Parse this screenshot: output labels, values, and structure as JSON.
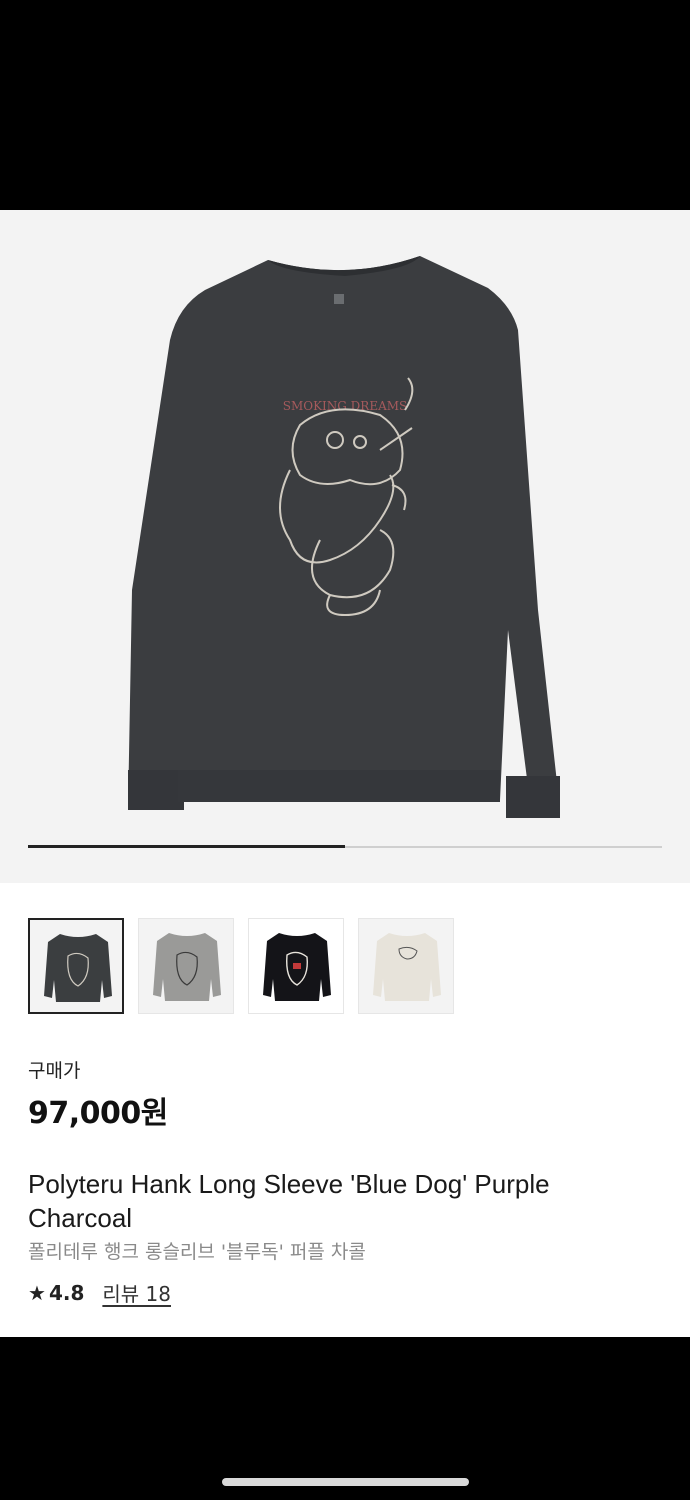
{
  "carousel": {
    "progress_fraction": 0.5,
    "print_text": "SMOKING DREAMS"
  },
  "thumbnails": [
    {
      "name": "charcoal",
      "color": "#3b3e40",
      "selected": true
    },
    {
      "name": "gray",
      "color": "#9a9a98",
      "selected": false
    },
    {
      "name": "black",
      "color": "#141418",
      "selected": false
    },
    {
      "name": "ivory",
      "color": "#e7e3da",
      "selected": false
    }
  ],
  "product": {
    "price_label": "구매가",
    "price": "97,000원",
    "name_en": "Polyteru Hank Long Sleeve 'Blue Dog' Purple Charcoal",
    "name_ko": "폴리테루 행크 롱슬리브 '블루독' 퍼플 차콜",
    "rating": "4.8",
    "review_link": "리뷰 18"
  },
  "icons": {
    "rating_star": "star-icon"
  }
}
